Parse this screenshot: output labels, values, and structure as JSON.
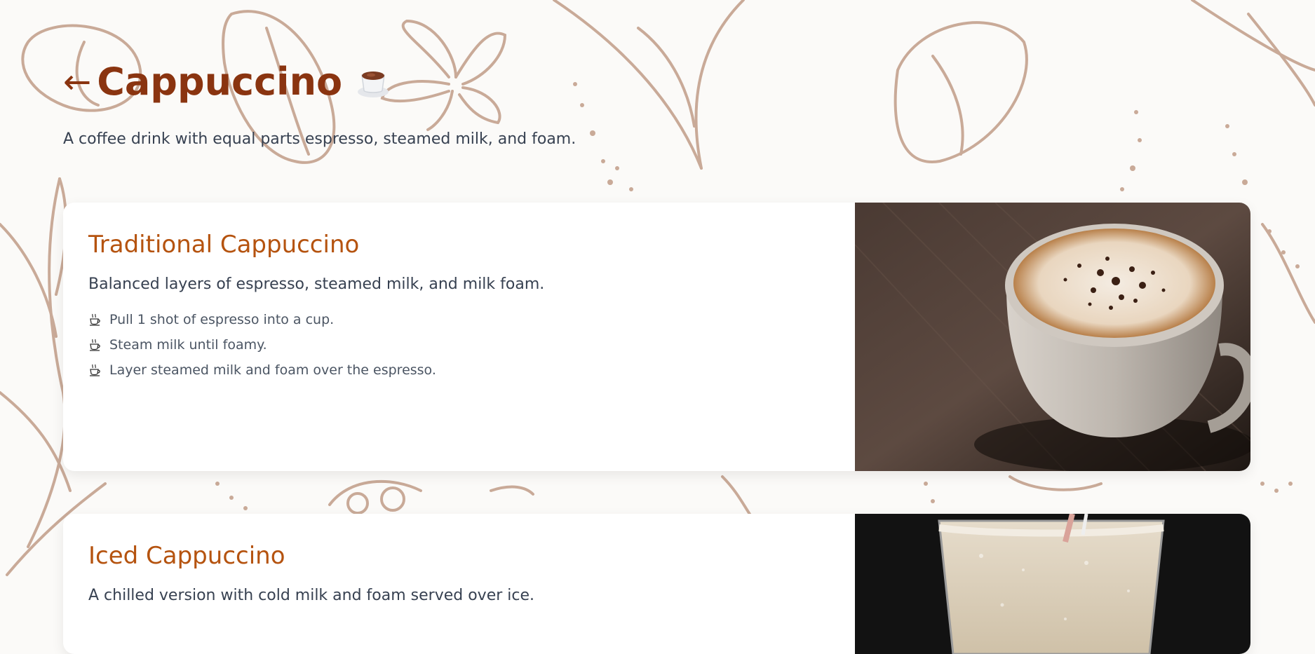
{
  "header": {
    "back_arrow": "←",
    "title": "Cappuccino",
    "title_icon": "coffee-cup-icon",
    "subtitle": "A coffee drink with equal parts espresso, steamed milk, and foam."
  },
  "recipes": [
    {
      "title": "Traditional Cappuccino",
      "description": "Balanced layers of espresso, steamed milk, and milk foam.",
      "step_icon": "hot-beverage-icon",
      "steps": [
        "Pull 1 shot of espresso into a cup.",
        "Steam milk until foamy.",
        "Layer steamed milk and foam over the espresso."
      ],
      "image": "cappuccino-photo"
    },
    {
      "title": "Iced Cappuccino",
      "description": "A chilled version with cold milk and foam served over ice.",
      "image": "iced-cappuccino-photo"
    }
  ],
  "colors": {
    "title": "#8a3410",
    "card_title": "#b5530f",
    "background_art": "#c9aa98"
  }
}
